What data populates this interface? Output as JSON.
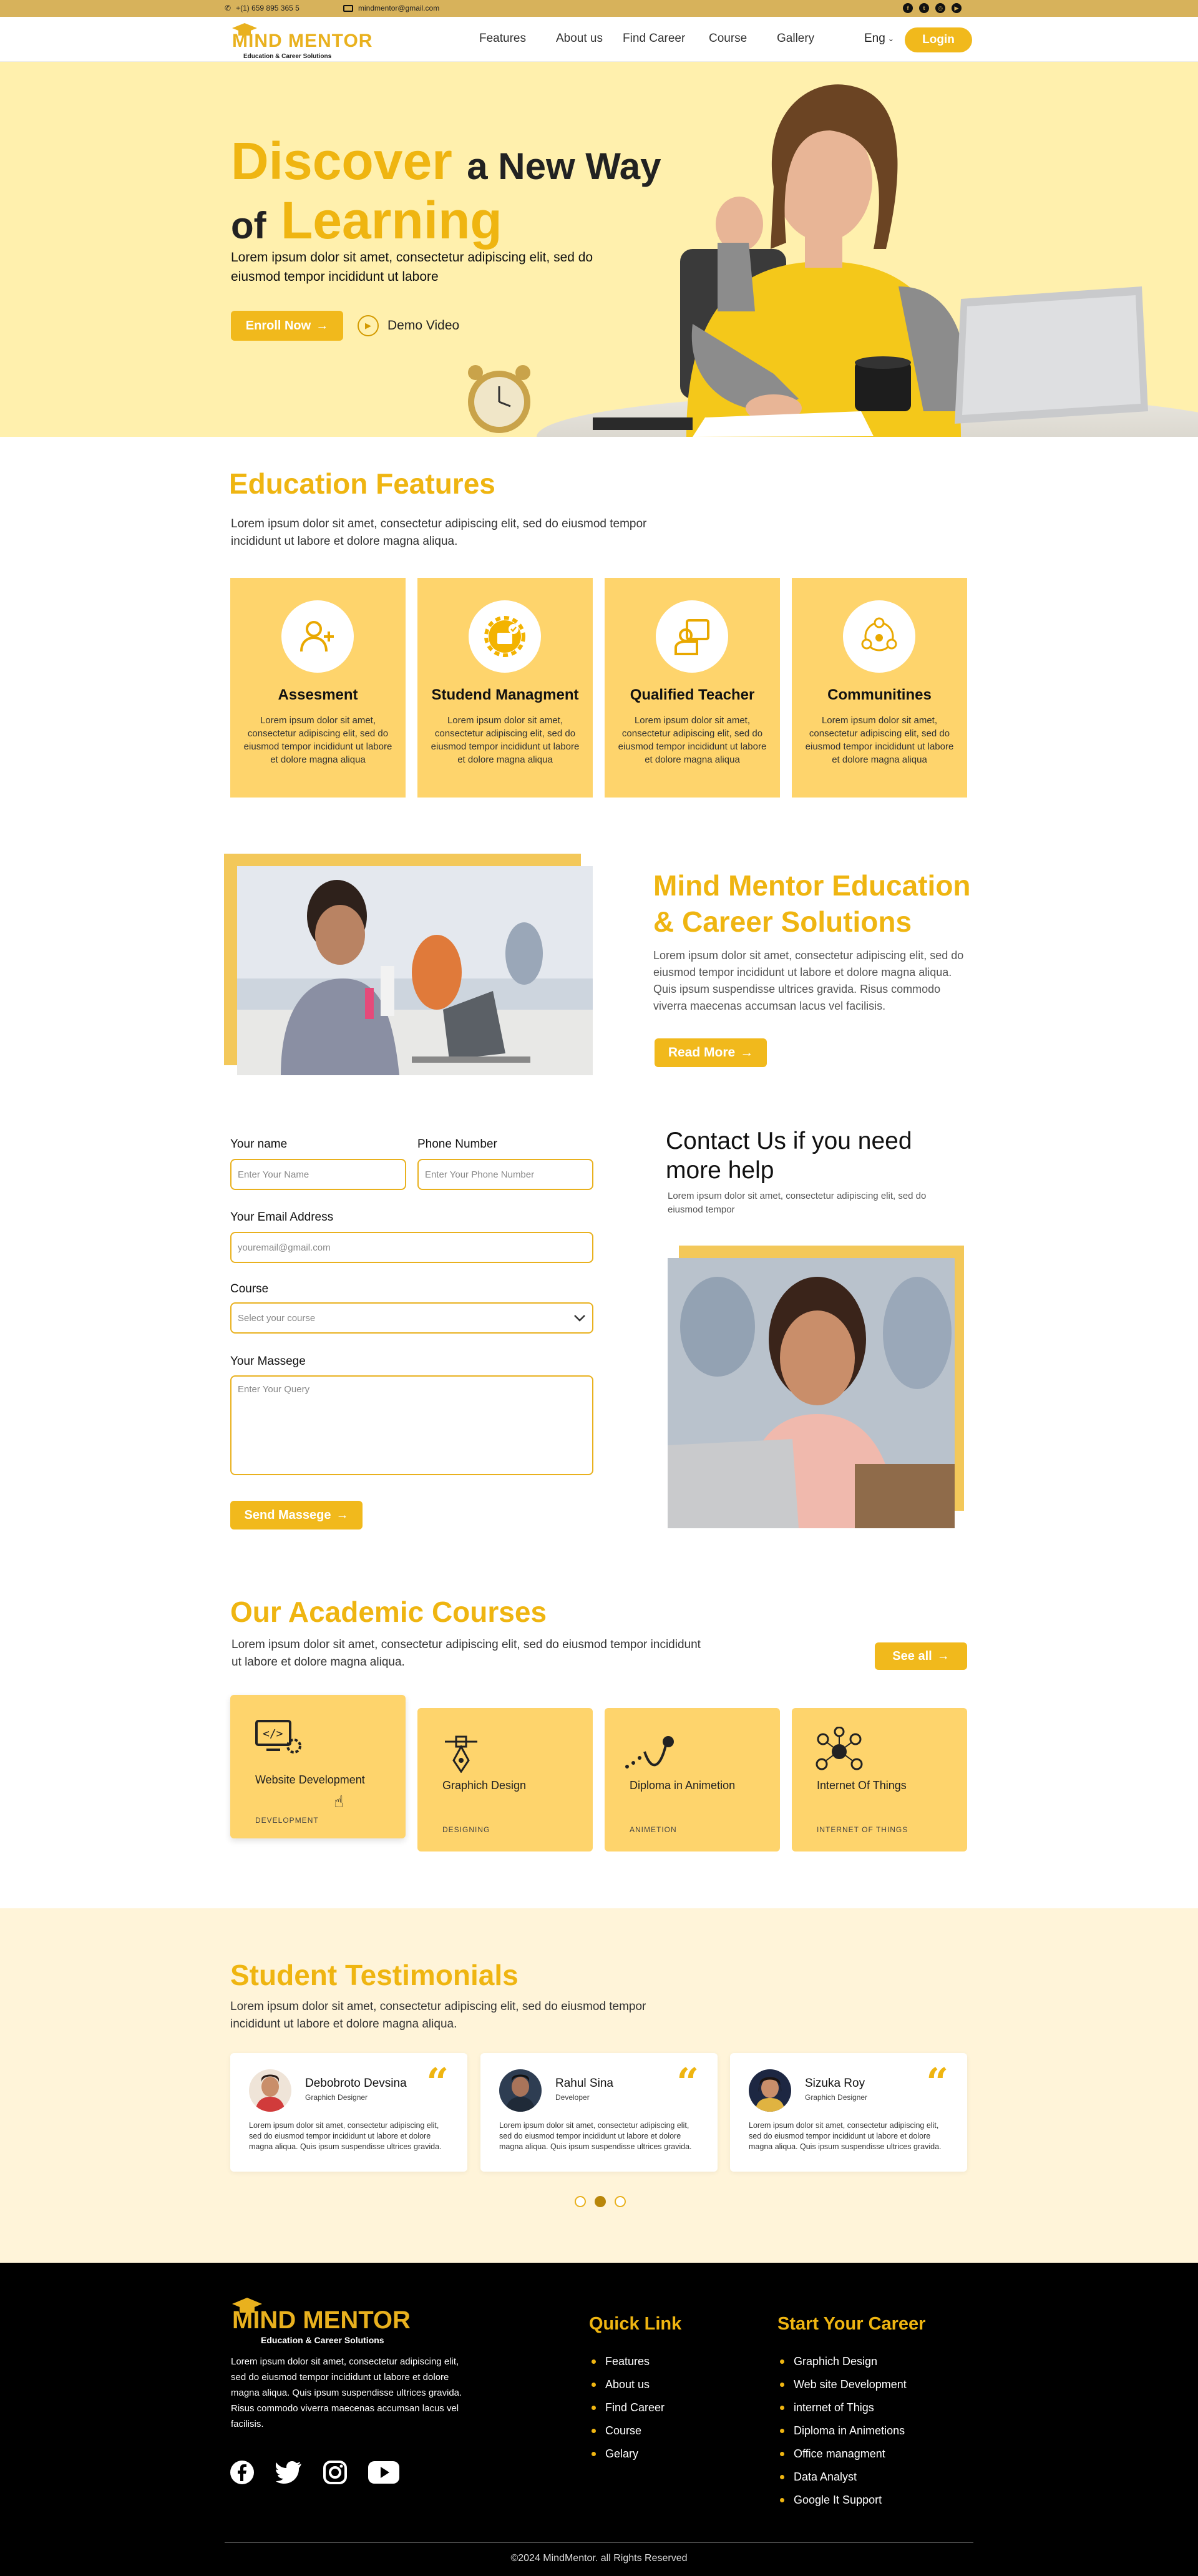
{
  "topbar": {
    "phone": "+(1) 659 895 365 5",
    "email": "mindmentor@gmail.com",
    "social_icons": [
      "facebook-icon",
      "twitter-icon",
      "instagram-icon",
      "youtube-icon"
    ]
  },
  "brand": {
    "name": "MIND MENTOR",
    "tagline": "Education & Career Solutions"
  },
  "nav": {
    "links": [
      "Features",
      "About us",
      "Find Career",
      "Course",
      "Gallery"
    ],
    "language": "Eng",
    "login": "Login"
  },
  "hero": {
    "title_word1": "Discover",
    "title_rest1": "a New Way",
    "title_of": "of",
    "title_word2": "Learning",
    "subtitle": "Lorem ipsum dolor sit amet, consectetur adipiscing elit, sed do eiusmod tempor incididunt ut labore",
    "enroll_label": "Enroll Now",
    "demo_label": "Demo Video"
  },
  "features": {
    "title": "Education Features",
    "intro": "Lorem ipsum dolor sit amet, consectetur adipiscing elit, sed do eiusmod tempor incididunt ut labore et dolore magna aliqua.",
    "cards": [
      {
        "title": "Assesment",
        "text": "Lorem ipsum dolor sit amet, consectetur adipiscing elit, sed do eiusmod tempor incididunt ut labore et dolore magna aliqua",
        "icon": "user-add-icon"
      },
      {
        "title": "Studend Managment",
        "text": "Lorem ipsum dolor sit amet, consectetur adipiscing elit, sed do eiusmod tempor incididunt ut labore et dolore magna aliqua",
        "icon": "student-management-icon"
      },
      {
        "title": "Qualified Teacher",
        "text": "Lorem ipsum dolor sit amet, consectetur adipiscing elit, sed do eiusmod tempor incididunt ut labore et dolore magna aliqua",
        "icon": "teacher-icon"
      },
      {
        "title": "Communitines",
        "text": "Lorem ipsum dolor sit amet, consectetur adipiscing elit, sed do eiusmod tempor incididunt ut labore et dolore magna aliqua",
        "icon": "community-icon"
      }
    ]
  },
  "about": {
    "title_line1": "Mind Mentor Education",
    "title_line2": "& Career Solutions",
    "text": "Lorem ipsum dolor sit amet, consectetur adipiscing elit, sed do eiusmod tempor incididunt ut labore et dolore magna aliqua. Quis ipsum suspendisse ultrices gravida. Risus commodo viverra maecenas accumsan lacus vel facilisis.",
    "button": "Read More"
  },
  "contact": {
    "name_label": "Your name",
    "name_placeholder": "Enter Your Name",
    "phone_label": "Phone Number",
    "phone_placeholder": "Enter Your Phone Number",
    "email_label": "Your Email Address",
    "email_placeholder": "youremail@gmail.com",
    "course_label": "Course",
    "course_placeholder": "Select your course",
    "message_label": "Your Massege",
    "message_placeholder": "Enter Your Query",
    "send_button": "Send Massege",
    "heading_line1": "Contact Us if you need",
    "heading_line2": "more help",
    "subtext": "Lorem ipsum dolor sit amet, consectetur adipiscing elit, sed do eiusmod tempor"
  },
  "courses": {
    "title": "Our Academic Courses",
    "intro": "Lorem ipsum dolor sit amet, consectetur adipiscing elit, sed do eiusmod tempor incididunt ut labore et dolore magna aliqua.",
    "see_all": "See all",
    "items": [
      {
        "title": "Website Development",
        "category": "DEVELOPMENT",
        "icon": "code-gear-icon"
      },
      {
        "title": "Graphich Design",
        "category": "DESIGNING",
        "icon": "pen-tool-icon"
      },
      {
        "title": "Diploma in Animetion",
        "category": "ANIMETION",
        "icon": "animation-curve-icon"
      },
      {
        "title": "Internet Of Things",
        "category": "INTERNET OF THINGS",
        "icon": "iot-network-icon"
      }
    ]
  },
  "testimonials": {
    "title": "Student Testimonials",
    "intro": "Lorem ipsum dolor sit amet, consectetur adipiscing elit, sed do eiusmod tempor incididunt ut labore et dolore magna aliqua.",
    "items": [
      {
        "name": "Debobroto Devsina",
        "role": "Graphich Designer",
        "quote_mark": "“",
        "text": "Lorem ipsum dolor sit amet, consectetur adipiscing elit, sed do eiusmod tempor incididunt ut labore et dolore magna aliqua. Quis ipsum suspendisse ultrices gravida."
      },
      {
        "name": "Rahul Sina",
        "role": "Developer",
        "quote_mark": "“",
        "text": "Lorem ipsum dolor sit amet, consectetur adipiscing elit, sed do eiusmod tempor incididunt ut labore et dolore magna aliqua. Quis ipsum suspendisse ultrices gravida."
      },
      {
        "name": "Sizuka Roy",
        "role": "Graphich Designer",
        "quote_mark": "“",
        "text": "Lorem ipsum dolor sit amet, consectetur adipiscing elit, sed do eiusmod tempor incididunt ut labore et dolore magna aliqua. Quis ipsum suspendisse ultrices gravida."
      }
    ],
    "active_dot": 2,
    "dot_count": 3
  },
  "footer": {
    "about": "Lorem ipsum dolor sit amet, consectetur adipiscing elit, sed do eiusmod tempor incididunt ut labore et dolore magna aliqua. Quis ipsum suspendisse ultrices gravida. Risus commodo viverra maecenas accumsan lacus vel facilisis.",
    "quick_title": "Quick Link",
    "quick_links": [
      "Features",
      "About us",
      "Find Career",
      "Course",
      "Gelary"
    ],
    "career_title": "Start Your Career",
    "career_links": [
      "Graphich Design",
      "Web site Development",
      "internet of Thigs",
      "Diploma in Animetions",
      "Office managment",
      "Data Analyst",
      "Google It Support"
    ],
    "copyright": "©2024 MindMentor. all Rights Reserved"
  },
  "colors": {
    "accent": "#efb511",
    "topbar": "#d7b25b",
    "hero_bg": "#fff0ad",
    "card_bg": "#fed46c",
    "testimonial_bg": "#fff4d9"
  }
}
